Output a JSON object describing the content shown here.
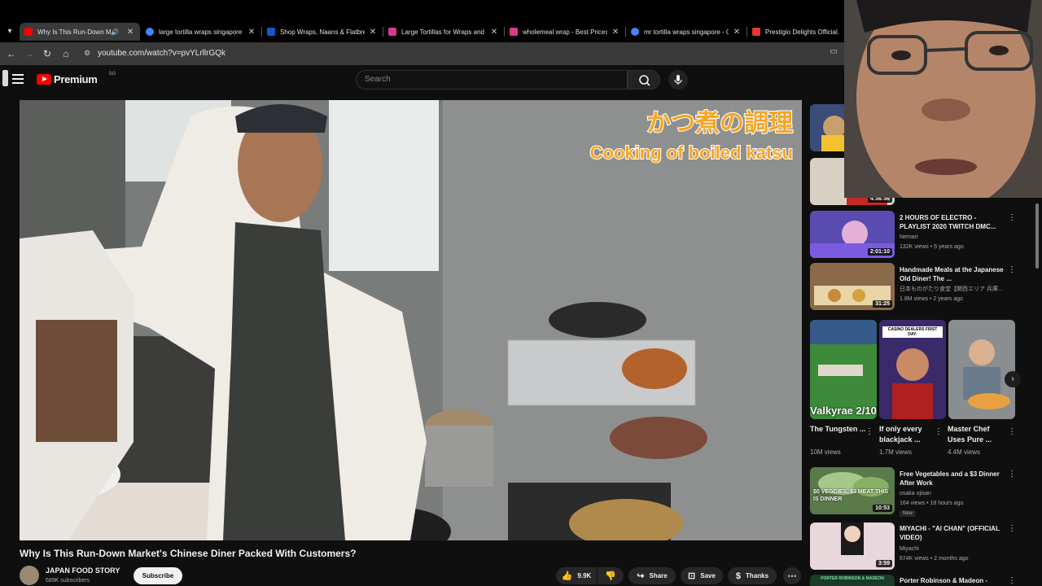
{
  "browser": {
    "tabs": [
      {
        "title": "Why Is This Run-Down Ma",
        "active": true,
        "favicon_color": "#ff0000",
        "audio": true
      },
      {
        "title": "large tortilla wraps singapore -",
        "favicon_color": "#4285f4"
      },
      {
        "title": "Shop Wraps, Naans & Flatbrea",
        "favicon_color": "#1a56c4"
      },
      {
        "title": "Large Tortillas for Wraps and B",
        "favicon_color": "#d9388b"
      },
      {
        "title": "wholemeal wrap - Best Prices ar",
        "favicon_color": "#d9388b"
      },
      {
        "title": "mr tortilla wraps singapore - G",
        "favicon_color": "#4285f4"
      },
      {
        "title": "Prestigio Delights Official, Onl",
        "favicon_color": "#e03b2f"
      }
    ],
    "url": "youtube.com/watch?v=pvYLrllrGQk"
  },
  "youtube": {
    "logo_text": "Premium",
    "logo_region": "SG",
    "search_placeholder": "Search"
  },
  "video": {
    "overlay_jp": "かつ煮の調理",
    "overlay_en": "Cooking of boiled katsu",
    "title": "Why Is This Run-Down Market's Chinese Diner Packed With Customers?",
    "channel": "JAPAN FOOD STORY",
    "subscribers": "689K subscribers",
    "subscribe_label": "Subscribe",
    "likes": "9.9K",
    "share_label": "Share",
    "save_label": "Save",
    "thanks_label": "Thanks"
  },
  "recommendations": [
    {
      "title": "",
      "duration": "4:56:56"
    },
    {
      "title": "2 HOURS OF ELECTRO - PLAYLIST 2020 TWITCH DMC...",
      "channel": "Nemari",
      "meta": "132K views • 5 years ago",
      "duration": "2:01:10"
    },
    {
      "title": "Handmade Meals at the Japanese Old Diner! The ...",
      "channel": "日本ものがたり食堂【関西エリア 兵庫...",
      "meta": "1.8M views • 2 years ago",
      "duration": "31:25"
    }
  ],
  "shorts": [
    {
      "title": "The Tungsten ...",
      "views": "10M views",
      "overlay": "Valkyrae 2/10"
    },
    {
      "title": "If only every blackjack ...",
      "views": "1.7M views",
      "overlay": "CASINO DEALERS FIRST DAY:"
    },
    {
      "title": "Master Chef Uses Pure ...",
      "views": "4.4M views"
    }
  ],
  "recommendations2": [
    {
      "title": "Free Vegetables and a $3 Dinner After Work",
      "channel": "osaka ojisan",
      "meta": "164 views • 18 hours ago",
      "badge": "New",
      "duration": "10:53",
      "overlay": "$0 VEGGIES, $3 MEAT THIS IS DINNER"
    },
    {
      "title": "MIYACHI - \"AI CHAN\" (OFFICIAL VIDEO)",
      "channel": "Miyachi",
      "meta": "674K views • 2 months ago",
      "duration": "3:59"
    },
    {
      "title": "Porter Robinson & Madeon -",
      "overlay": "PORTER ROBINSON & MADEON"
    }
  ],
  "colors": {
    "brand": "#ff0000",
    "bg": "#0f0f0f"
  }
}
